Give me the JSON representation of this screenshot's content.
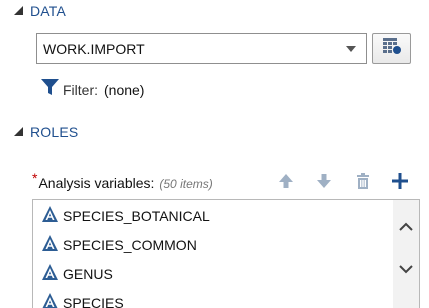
{
  "data_section": {
    "title": "DATA",
    "dataset_value": "WORK.IMPORT",
    "filter_label": "Filter:",
    "filter_value": "(none)"
  },
  "roles_section": {
    "title": "ROLES",
    "analysis_label": "Analysis variables:",
    "item_count": "(50 items)",
    "required_marker": "*",
    "variables": [
      {
        "name": "SPECIES_BOTANICAL",
        "icon": "character-variable-icon"
      },
      {
        "name": "SPECIES_COMMON",
        "icon": "character-variable-icon"
      },
      {
        "name": "GENUS",
        "icon": "character-variable-icon"
      },
      {
        "name": "SPECIES",
        "icon": "character-variable-icon"
      }
    ]
  },
  "colors": {
    "section_title": "#1f4f8e",
    "required": "#c00000",
    "action_blue": "#1f4f8e",
    "disabled_icon": "#9fb0c4"
  }
}
